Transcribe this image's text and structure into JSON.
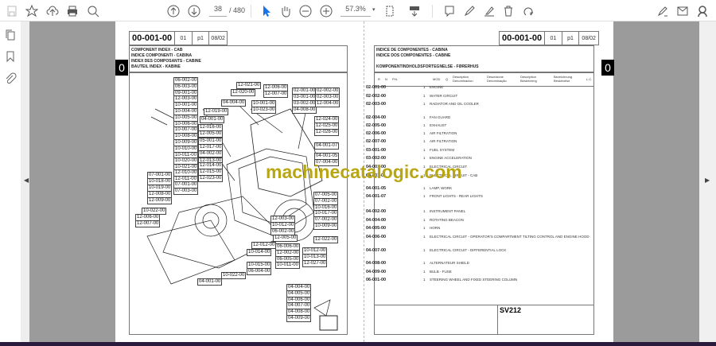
{
  "toolbar": {
    "page_current": "38",
    "page_total": "/ 480",
    "zoom": "57.3%",
    "zoom_dropdown": "▾"
  },
  "icons": [
    "save-icon",
    "bookmark-star-icon",
    "upload-icon",
    "print-icon",
    "search-icon",
    "page-up-icon",
    "page-down-icon",
    "select-cursor-icon",
    "hand-icon",
    "zoom-out-icon",
    "zoom-in-icon",
    "fit-page-icon",
    "scroll-mode-icon",
    "comment-icon",
    "pen-icon",
    "sign-icon",
    "delete-icon",
    "rotate-icon",
    "fill-sign-icon",
    "email-icon",
    "account-icon"
  ],
  "left_nav": [
    "page-thumbnails-icon",
    "bookmarks-icon",
    "attachments-icon"
  ],
  "left_page": {
    "code": "00-001-00",
    "rev": "01",
    "page": "p1",
    "date": "08/02",
    "tab": "0",
    "titles": [
      "COMPONENT INDEX - CAB",
      "INDICE COMPONENTI - CABINA",
      "INDEX DES COMPOSANTS - CABINE",
      "BAUTEIL INDEX - KABINE"
    ],
    "callouts": [
      "06-002-00",
      "06-003-00",
      "09-001-00",
      "12-003-00",
      "10-001-00",
      "10-004-00",
      "10-005-00",
      "10-006-00",
      "10-007-00",
      "10-008-00",
      "10-009-00",
      "10-010-00",
      "10-011-00",
      "10-020-00",
      "10-021-00",
      "12-010-00",
      "12-011-00",
      "07-001-00",
      "10-018-00",
      "10-019-00",
      "07-001-00",
      "07-003-00",
      "12-008-00",
      "12-009-00",
      "10-022-00",
      "12-006-00",
      "12-007-00",
      "12-021-00",
      "12-020-00",
      "12-006-00",
      "12-007-00",
      "02-001-00",
      "03-001-00",
      "03-002-00",
      "02-002-00",
      "02-003-00",
      "12-004-00",
      "10-001-00",
      "10-023-00",
      "04-008-00",
      "04-004-00",
      "12-019-00",
      "04-001-00",
      "12-016-00",
      "12-005-00",
      "05-001-00",
      "12-017-00",
      "04-002-00",
      "12-013-00",
      "12-014-00",
      "12-015-00",
      "12-023-00",
      "12-024-00",
      "12-025-00",
      "12-026-00",
      "04-001-07",
      "04-001-05",
      "07-004-00",
      "07-005-00",
      "07-002-00",
      "10-016-00",
      "10-017-00",
      "07-002-00",
      "10-009-00",
      "12-022-00",
      "12-003-00",
      "10-012-00",
      "06-002-00",
      "12-005-00",
      "12-012-00",
      "10-014-00",
      "10-015-00",
      "06-004-00",
      "06-006-00",
      "12-002-00",
      "06-005-00",
      "10-011-00",
      "10-012-00",
      "10-013-00",
      "12-027-00",
      "10-022-00",
      "04-001-00",
      "04-004-00",
      "04-005-00",
      "04-006-00",
      "04-007-00",
      "04-008-00",
      "04-009-00"
    ]
  },
  "right_page": {
    "code": "00-001-00",
    "rev": "01",
    "page": "p1",
    "date": "08/02",
    "tab": "0",
    "titles": [
      "INDICE DE COMPONENTES - CABINA",
      "INDICE DOS COMPONENTES - CABINE",
      "KOMPONENTINDHOLDSFORTEGNELSE - FØRERHUS"
    ],
    "columns": [
      "R",
      "N",
      "P.N.",
      "MOD",
      "Q",
      "Description\nDenominacion",
      "Descrizione\nDenominação",
      "Description\nBeskrivning",
      "Bezeichnung\nBeskrivelse",
      "L.C."
    ],
    "rows": [
      {
        "code": "02-001-00",
        "q": "1",
        "desc": "ENGINE"
      },
      {
        "code": "02-002-00",
        "q": "1",
        "desc": "WATER CIRCUIT"
      },
      {
        "code": "02-003-00",
        "q": "1",
        "desc": "RADIATOR AND OIL COOLER"
      },
      {
        "code": "02-004-00",
        "q": "1",
        "desc": "FAN GUARD"
      },
      {
        "code": "02-005-00",
        "q": "1",
        "desc": "EXHAUST"
      },
      {
        "code": "02-006-00",
        "q": "1",
        "desc": "AIR FILTRATION"
      },
      {
        "code": "02-007-00",
        "q": "1",
        "desc": "AIR FILTRATION"
      },
      {
        "code": "03-001-00",
        "q": "1",
        "desc": "FUEL SYSTEM"
      },
      {
        "code": "03-002-00",
        "q": "1",
        "desc": "ENGINE ACCELERATION"
      },
      {
        "code": "04-001-00",
        "q": "1",
        "desc": "ELECTRICAL CIRCUIT"
      },
      {
        "code": "04-001-01",
        "q": "1",
        "desc": "ELECTRICAL CIRCUIT - CAB"
      },
      {
        "code": "04-001-05",
        "q": "1",
        "desc": "LAMP, WORK"
      },
      {
        "code": "04-001-07",
        "q": "1",
        "desc": "FRONT LIGHTS - REAR LIGHTS"
      },
      {
        "code": "04-002-00",
        "q": "1",
        "desc": "INSTRUMENT PANEL"
      },
      {
        "code": "04-004-00",
        "q": "1",
        "desc": "ROTATING BEACON"
      },
      {
        "code": "04-005-00",
        "q": "1",
        "desc": "HORN"
      },
      {
        "code": "04-006-00",
        "q": "1",
        "desc": "ELECTRICAL CIRCUIT - OPERATOR'S COMPARTMENT TILTING CONTROL AND ENGINE HOOD"
      },
      {
        "code": "04-007-00",
        "q": "1",
        "desc": "ELECTRICAL CIRCUIT - DIFFERENTIAL LOCK"
      },
      {
        "code": "04-008-00",
        "q": "1",
        "desc": "ALTERNATEUR SHIELD"
      },
      {
        "code": "04-009-00",
        "q": "1",
        "desc": "BULB - FUSE"
      },
      {
        "code": "06-001-00",
        "q": "1",
        "desc": "STEERING WHEEL AND FIXED STEERING COLUMN"
      }
    ],
    "model": "SV212"
  },
  "watermark": "machinecatalogic.com",
  "colors": {
    "viewer_gray": "#9b9b9b",
    "watermark": "#b8a614",
    "accent_blue": "#1a73e8"
  }
}
